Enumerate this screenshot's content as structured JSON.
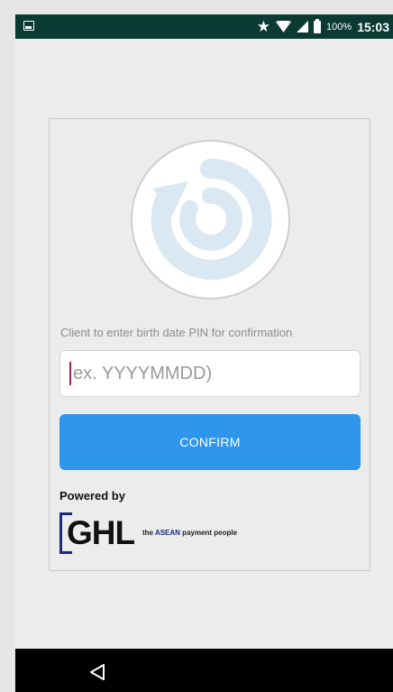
{
  "status_bar": {
    "battery_percent": "100%",
    "time": "15:03",
    "icons": [
      "gallery-icon",
      "star-icon",
      "wifi-icon",
      "signal-icon",
      "battery-icon"
    ]
  },
  "card": {
    "logo_icon": "refresh-circle-icon",
    "instruction": "Client to enter birth date PIN for confirmation",
    "pin_input": {
      "value": "",
      "placeholder": "ex. YYYYMMDD)"
    },
    "confirm_label": "CONFIRM",
    "powered_by": "Powered by",
    "brand": {
      "name": "GHL",
      "tag_prefix": "the ",
      "tag_highlight": "ASEAN",
      "tag_suffix": " payment people"
    }
  },
  "nav": {
    "back_icon": "back-triangle-icon"
  },
  "colors": {
    "status_bar": "#0b3a33",
    "accent": "#2f96ee",
    "brand": "#1f2a7a"
  }
}
